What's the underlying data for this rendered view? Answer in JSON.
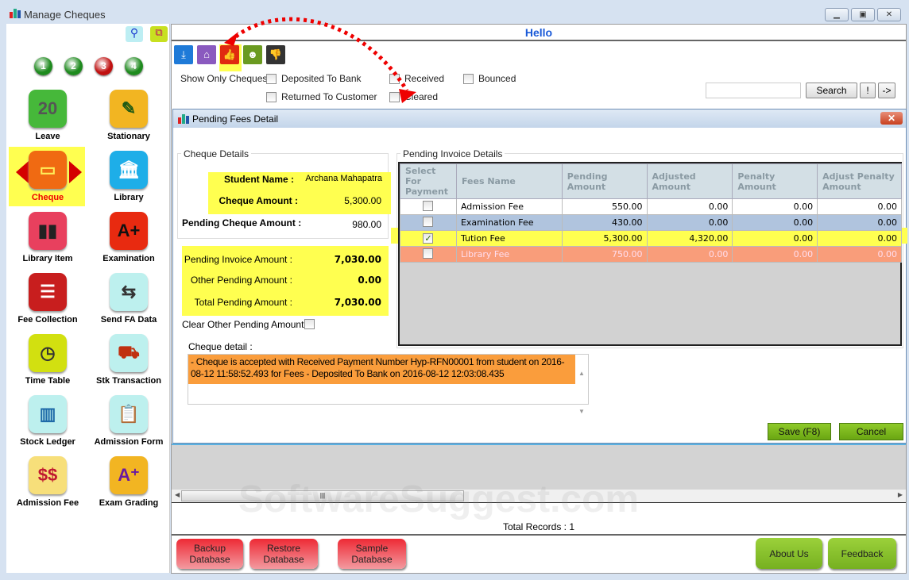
{
  "window": {
    "title": "Manage Cheques",
    "controls": [
      "minimize",
      "maximize",
      "close"
    ]
  },
  "sidebar": {
    "steps": [
      {
        "label": "1",
        "color": "#1e8a1e"
      },
      {
        "label": "2",
        "color": "#1e8a1e"
      },
      {
        "label": "3",
        "color": "#c01010"
      },
      {
        "label": "4",
        "color": "#1e8a1e"
      }
    ],
    "items": [
      {
        "label": "Leave",
        "icon": "calendar-icon",
        "glyph": "20",
        "bg": "#46b83a",
        "fg": "#555"
      },
      {
        "label": "Stationary",
        "icon": "pencil-cup-icon",
        "glyph": "✎",
        "bg": "#f2b522",
        "fg": "#1e5a14"
      },
      {
        "label": "Cheque",
        "icon": "cheque-icon",
        "glyph": "▭",
        "bg": "#f06a12",
        "fg": "#ffef5a",
        "active": true
      },
      {
        "label": "Library",
        "icon": "library-building-icon",
        "glyph": "🏛",
        "bg": "#1eaee8",
        "fg": "#fff"
      },
      {
        "label": "Library Item",
        "icon": "books-icon",
        "glyph": "▮▮",
        "bg": "#e8405e",
        "fg": "#222"
      },
      {
        "label": "Examination",
        "icon": "exam-paper-icon",
        "glyph": "A+",
        "bg": "#e82a10",
        "fg": "#111"
      },
      {
        "label": "Fee Collection",
        "icon": "fee-list-icon",
        "glyph": "☰",
        "bg": "#c81e1e",
        "fg": "#fff"
      },
      {
        "label": "Send FA Data",
        "icon": "transfer-arrows-icon",
        "glyph": "⇆",
        "bg": "#bdf0ee",
        "fg": "#333"
      },
      {
        "label": "Time Table",
        "icon": "clock-icon",
        "glyph": "◷",
        "bg": "#d2e010",
        "fg": "#333"
      },
      {
        "label": "Stk Transaction",
        "icon": "trolley-icon",
        "glyph": "⛟",
        "bg": "#bdf0ee",
        "fg": "#c03010"
      },
      {
        "label": "Stock Ledger",
        "icon": "bar-chart-icon",
        "glyph": "▥",
        "bg": "#bdf0ee",
        "fg": "#1e6aa8"
      },
      {
        "label": "Admission Form",
        "icon": "clipboard-icon",
        "glyph": "📋",
        "bg": "#bdf0ee",
        "fg": "#333"
      },
      {
        "label": "Admission Fee",
        "icon": "money-clipboard-icon",
        "glyph": "$$",
        "bg": "#f7df7a",
        "fg": "#c01830"
      },
      {
        "label": "Exam Grading",
        "icon": "grade-icon",
        "glyph": "A⁺",
        "bg": "#f2b522",
        "fg": "#6a1aa0"
      }
    ]
  },
  "header": {
    "title": "Hello"
  },
  "toolbar": [
    {
      "icon": "download-icon",
      "glyph": "⤓",
      "bg": "#1e7ad8"
    },
    {
      "icon": "bank-icon",
      "glyph": "⌂",
      "bg": "#8a5abf"
    },
    {
      "icon": "thumbs-up-icon",
      "glyph": "👍",
      "bg": "#e02a10"
    },
    {
      "icon": "customer-icon",
      "glyph": "☻",
      "bg": "#6a9a20"
    },
    {
      "icon": "thumbs-down-icon",
      "glyph": "👎",
      "bg": "#333"
    }
  ],
  "filters": {
    "label": "Show Only Cheques:",
    "options": [
      "Deposited To Bank",
      "Received",
      "Bounced",
      "Returned To Customer",
      "Cleared"
    ]
  },
  "search": {
    "value": "",
    "button": "Search",
    "btn2": "!",
    "btn3": "->"
  },
  "dialog": {
    "title": "Pending Fees Detail",
    "cheque_details": {
      "label": "Cheque Details",
      "student_name_label": "Student Name :",
      "student_name": "Archana Mahapatra",
      "cheque_amount_label": "Cheque Amount :",
      "cheque_amount": "5,300.00",
      "pending_cheque_label": "Pending Cheque Amount :",
      "pending_cheque": "980.00"
    },
    "totals": {
      "pending_invoice_label": "Pending Invoice Amount :",
      "pending_invoice": "7,030.00",
      "other_pending_label": "Other Pending Amount :",
      "other_pending": "0.00",
      "total_pending_label": "Total Pending Amount :",
      "total_pending": "7,030.00"
    },
    "clear_other_label": "Clear Other Pending Amount :",
    "cheque_detail_label": "Cheque detail :",
    "cheque_detail_text": "- Cheque is accepted with Received Payment Number Hyp-RFN00001 from student on 2016-08-12 11:58:52.493 for Fees - Deposited To Bank on 2016-08-12 12:03:08.435",
    "invoice": {
      "label": "Pending Invoice Details",
      "columns": [
        "Select For Payment",
        "Fees Name",
        "Pending Amount",
        "Adjusted Amount",
        "Penalty Amount",
        "Adjust Penalty Amount"
      ],
      "rows": [
        {
          "checked": false,
          "name": "Admission Fee",
          "pending": "550.00",
          "adjusted": "0.00",
          "penalty": "0.00",
          "adj_penalty": "0.00",
          "bg": "#ffffff",
          "fg": "#000"
        },
        {
          "checked": false,
          "name": "Examination Fee",
          "pending": "430.00",
          "adjusted": "0.00",
          "penalty": "0.00",
          "adj_penalty": "0.00",
          "bg": "#b0c4de",
          "fg": "#000"
        },
        {
          "checked": true,
          "name": "Tution Fee",
          "pending": "5,300.00",
          "adjusted": "4,320.00",
          "penalty": "0.00",
          "adj_penalty": "0.00",
          "bg": "#ffff50",
          "fg": "#000"
        },
        {
          "checked": false,
          "name": "Library Fee",
          "pending": "750.00",
          "adjusted": "0.00",
          "penalty": "0.00",
          "adj_penalty": "0.00",
          "bg": "#f99d7a",
          "fg": "#fde"
        }
      ]
    },
    "save": "Save (F8)",
    "cancel": "Cancel"
  },
  "status": {
    "total_records": "Total Records : 1"
  },
  "footer": {
    "backup": "Backup Database",
    "restore": "Restore Database",
    "sample": "Sample Database",
    "about": "About Us",
    "feedback": "Feedback"
  },
  "watermark": "SoftwareSuggest.com"
}
